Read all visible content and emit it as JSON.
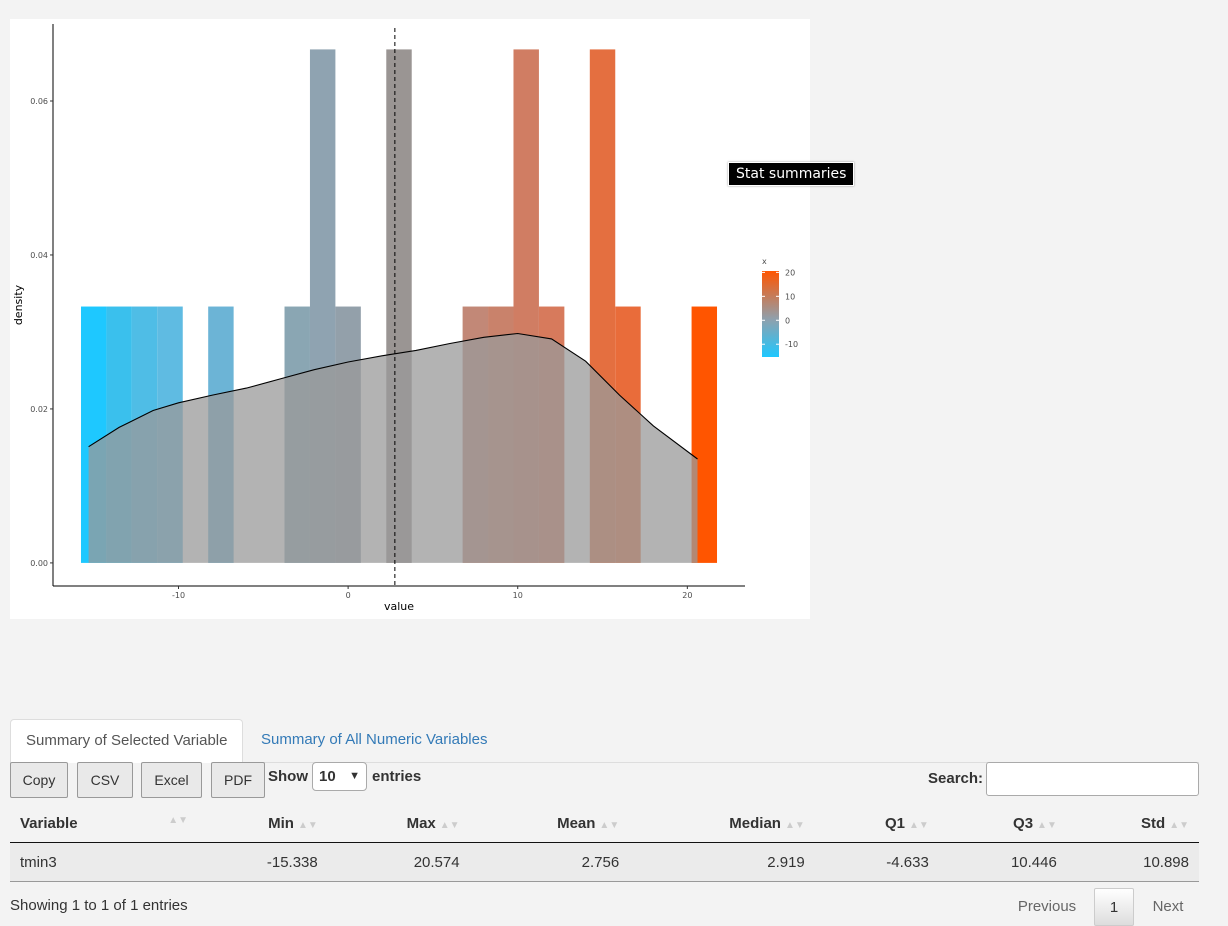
{
  "tooltip": "Stat summaries",
  "chart_data": {
    "type": "bar",
    "subtype": "histogram-with-density",
    "xlabel": "value",
    "ylabel": "density",
    "xlim": [
      -17.4,
      23.4
    ],
    "ylim": [
      -0.003,
      0.07
    ],
    "x_ticks": [
      -10,
      0,
      10,
      20
    ],
    "x_tick_labels": [
      "-10",
      "0",
      "10",
      "20"
    ],
    "y_ticks": [
      0.0,
      0.02,
      0.04,
      0.06
    ],
    "y_tick_labels": [
      "0.00",
      "0.02",
      "0.04",
      "0.06"
    ],
    "grid": false,
    "bins": [
      {
        "x": -15.0,
        "density": 0.0333,
        "color": "#1ec8ff"
      },
      {
        "x": -13.5,
        "density": 0.0333,
        "color": "#3ac0ed"
      },
      {
        "x": -12.0,
        "density": 0.0333,
        "color": "#4fbde6"
      },
      {
        "x": -10.5,
        "density": 0.0333,
        "color": "#5fbbe2"
      },
      {
        "x": -7.5,
        "density": 0.0333,
        "color": "#6cb4d6"
      },
      {
        "x": -3.0,
        "density": 0.0333,
        "color": "#8aa6b3"
      },
      {
        "x": -1.5,
        "density": 0.0667,
        "color": "#8fa3b1"
      },
      {
        "x": 0.0,
        "density": 0.0333,
        "color": "#93a0aa"
      },
      {
        "x": 3.0,
        "density": 0.0667,
        "color": "#9a9593"
      },
      {
        "x": 7.5,
        "density": 0.0333,
        "color": "#c28877"
      },
      {
        "x": 9.0,
        "density": 0.0333,
        "color": "#c9826b"
      },
      {
        "x": 10.5,
        "density": 0.0667,
        "color": "#d07d63"
      },
      {
        "x": 12.0,
        "density": 0.0333,
        "color": "#d77a5c"
      },
      {
        "x": 15.0,
        "density": 0.0667,
        "color": "#e46f40"
      },
      {
        "x": 16.5,
        "density": 0.0333,
        "color": "#e96c3a"
      },
      {
        "x": 21.0,
        "density": 0.0333,
        "color": "#ff5500"
      }
    ],
    "bin_width": 1.5,
    "density_curve": {
      "x": [
        -15.3,
        -13.5,
        -11.5,
        -10,
        -8,
        -6,
        -4,
        -2,
        0,
        2,
        4,
        6,
        8,
        10,
        12,
        14,
        16,
        18,
        20.6
      ],
      "y": [
        0.0151,
        0.0176,
        0.0198,
        0.0208,
        0.0218,
        0.0227,
        0.0239,
        0.0251,
        0.0261,
        0.0269,
        0.0276,
        0.0285,
        0.0293,
        0.0298,
        0.0291,
        0.0262,
        0.0218,
        0.0178,
        0.0135
      ],
      "fill": "#999999"
    },
    "mean_line": {
      "x": 2.756,
      "style": "dashed"
    },
    "legend": {
      "title": "x",
      "labels": [
        "20",
        "10",
        "0",
        "-10"
      ],
      "values": [
        20,
        10,
        0,
        -10
      ],
      "low_color": "#1ec8ff",
      "high_color": "#ff5500",
      "range": [
        -15.338,
        20.574
      ],
      "position": "right"
    }
  },
  "tabs": [
    {
      "label": "Summary of Selected Variable"
    },
    {
      "label": "Summary of All Numeric Variables"
    }
  ],
  "buttons": {
    "copy": "Copy",
    "csv": "CSV",
    "excel": "Excel",
    "pdf": "PDF"
  },
  "length_menu": {
    "show": "Show",
    "value": "10",
    "entries": "entries"
  },
  "search": {
    "label": "Search:",
    "value": ""
  },
  "table": {
    "headers": [
      "Variable",
      "Min",
      "Max",
      "Mean",
      "Median",
      "Q1",
      "Q3",
      "Std"
    ],
    "rows": [
      [
        "tmin3",
        "-15.338",
        "20.574",
        "2.756",
        "2.919",
        "-4.633",
        "10.446",
        "10.898"
      ]
    ]
  },
  "info": "Showing 1 to 1 of 1 entries",
  "pagination": {
    "previous": "Previous",
    "current": "1",
    "next": "Next"
  }
}
